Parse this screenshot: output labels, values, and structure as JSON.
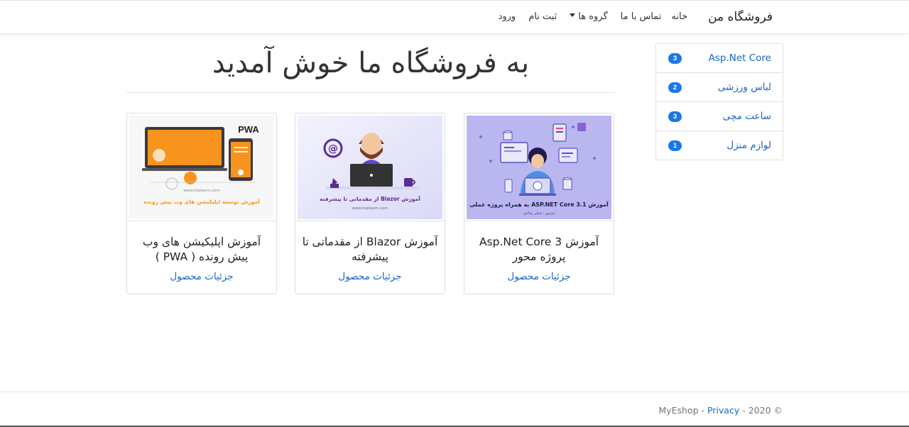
{
  "navbar": {
    "brand": "فروشگاه من",
    "links": {
      "home": "خانه",
      "contact": "تماس با ما",
      "groups": "گروه ها",
      "register": "ثبت نام",
      "login": "ورود"
    }
  },
  "sidebar": {
    "items": [
      {
        "label": "Asp.Net Core",
        "count": "3"
      },
      {
        "label": "لباس ورزشی",
        "count": "2"
      },
      {
        "label": "ساعت مچی",
        "count": "3"
      },
      {
        "label": "لوازم منزل",
        "count": "1"
      }
    ]
  },
  "main": {
    "title": "به فروشگاه ما خوش آمدید"
  },
  "products": [
    {
      "title": "آموزش Asp.Net Core 3 پروژه محور",
      "link": "جزئیات محصول",
      "image_text": "آموزش ASP.NET Core 3.1 به همراه پروژه عملی",
      "image_subtext": "مدرس : ایمان مدائنی",
      "image_bg": "#b9b6f0"
    },
    {
      "title": "آموزش Blazor از مقدماتی تا پیشرفته",
      "link": "جزئیات محصول",
      "image_text": "آموزش Blazor از مقدماتی تا پیشرفته",
      "image_subtext": "www.toplearn.com",
      "image_bg": "#e8e8fb"
    },
    {
      "title": "آموزش اپلیکیشن های وب پیش رونده ( PWA )",
      "link": "جزئیات محصول",
      "image_text": "آموزش توسعه اپلیکیشن های وب پیش رونده",
      "image_subtext": "www.toplearn.com",
      "image_badge": "PWA",
      "image_bg": "#f7f7f7"
    }
  ],
  "footer": {
    "prefix": "MyEshop - ",
    "privacy": "Privacy",
    "suffix": " - 2020 ©"
  },
  "colors": {
    "link": "#1a66c2",
    "badge": "#1a78e6",
    "orange": "#f7941d"
  }
}
